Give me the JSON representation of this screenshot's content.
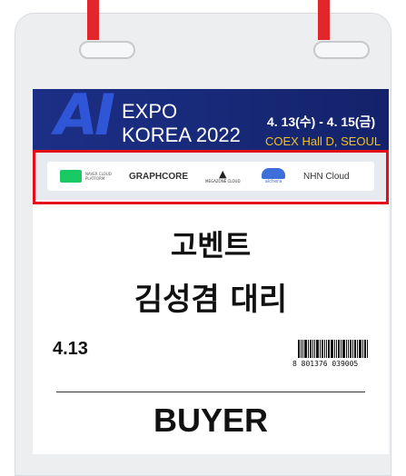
{
  "badge": {
    "banner": {
      "ai": "AI",
      "expo": "EXPO",
      "korea": "KOREA 2022",
      "dates": "4. 13(수) - 4. 15(금)",
      "venue": "COEX Hall D, SEOUL"
    },
    "sponsors": [
      {
        "name": "NAVER CLOUD PLATFORM"
      },
      {
        "name": "GRAPHCORE"
      },
      {
        "name": "MEGAZONE CLOUD"
      },
      {
        "name": "alchera"
      },
      {
        "name": "NHN Cloud"
      }
    ],
    "company": "고벤트",
    "person": "김성겸 대리",
    "date": "4.13",
    "barcode_number": "8 801376 039005",
    "role": "BUYER"
  },
  "colors": {
    "strap": "#e3262b",
    "banner_bg": "#1c2f86",
    "ai_accent": "#2f56d6",
    "venue_text": "#f2c020",
    "highlight_box": "#e3101a"
  }
}
